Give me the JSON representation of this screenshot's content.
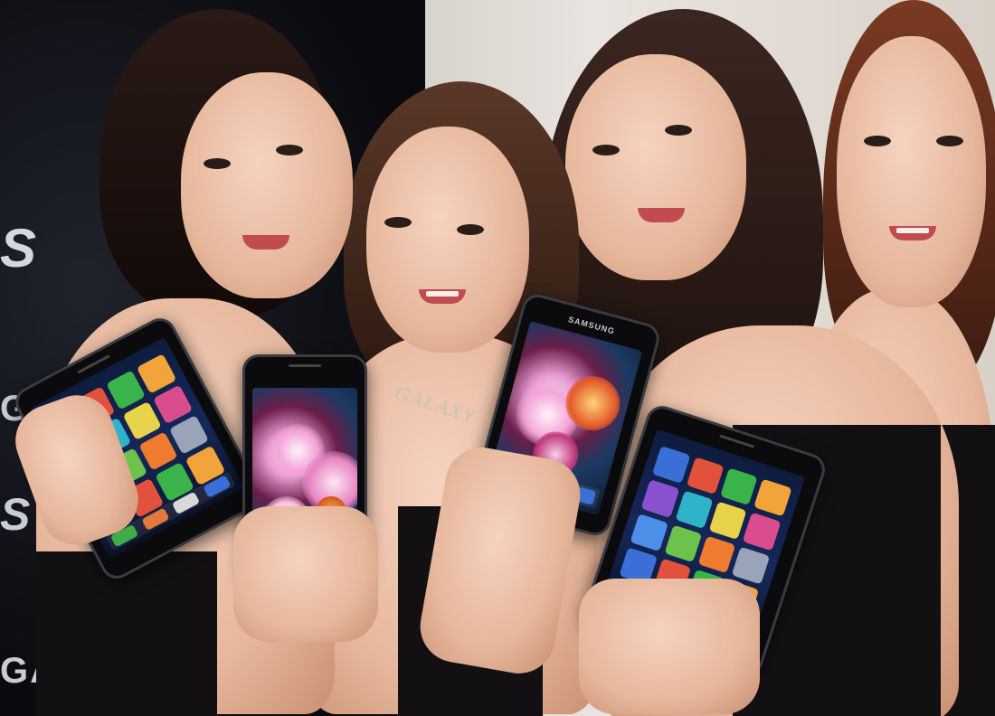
{
  "scene": {
    "description_tags": [
      "promo-photo",
      "four-models",
      "smartphones"
    ],
    "backdrop": {
      "left_logo_glyph": "S",
      "left_text_fragment": "GA",
      "colors": {
        "dark": "#0b0b10",
        "wall": "#e9e4df"
      }
    },
    "phones": [
      {
        "name": "phone-1",
        "screen": "home",
        "brand": ""
      },
      {
        "name": "phone-2",
        "screen": "flower-wallpaper",
        "brand": ""
      },
      {
        "name": "phone-3",
        "screen": "flower-wallpaper",
        "brand": "SAMSUNG"
      },
      {
        "name": "phone-4",
        "screen": "home",
        "brand": ""
      }
    ],
    "necklace_text": "GALAXY",
    "icon_colors": [
      "#3a6fd8",
      "#e2513b",
      "#39b34a",
      "#f2a33a",
      "#8a52d1",
      "#2fb3c8",
      "#e8d34a",
      "#d94d8e",
      "#4d8fe8",
      "#6cc24a",
      "#ef7b2f",
      "#9aa4b8"
    ]
  }
}
